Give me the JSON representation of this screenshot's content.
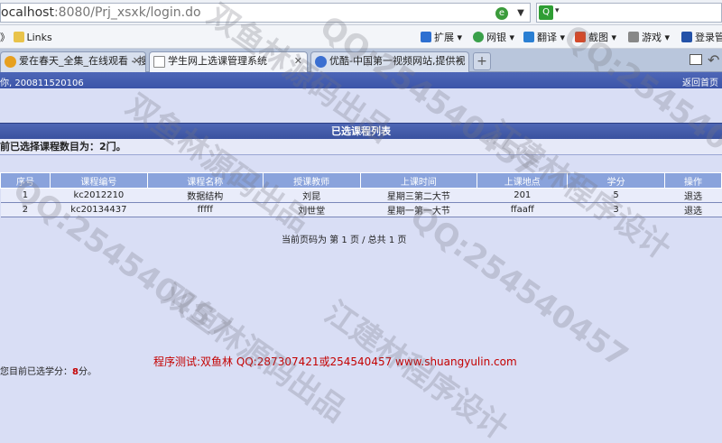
{
  "browser": {
    "url_main": "ocalhost",
    "url_rest": ":8080/Prj_xsxk/login.do",
    "bookmarks_link": "Links",
    "toolbar": [
      "扩展",
      "网银",
      "翻译",
      "截图",
      "游戏",
      "登录管"
    ],
    "tabs": [
      {
        "label": "爱在春天_全集_在线观看 - 搜"
      },
      {
        "label": "学生网上选课管理系统"
      },
      {
        "label": "优酷-中国第一视频网站,提供视"
      }
    ]
  },
  "header": {
    "welcome": "你, 200811520106",
    "home_link": "返回首页"
  },
  "list": {
    "title": "已选课程列表",
    "count_text": "前已选择课程数目为：2门。",
    "columns": [
      "序号",
      "课程编号",
      "课程名称",
      "授课教师",
      "上课时间",
      "上课地点",
      "学分",
      "操作"
    ],
    "rows": [
      [
        "1",
        "kc2012210",
        "数据结构",
        "刘昆",
        "星期三第二大节",
        "201",
        "5",
        "退选"
      ],
      [
        "2",
        "kc20134437",
        "fffff",
        "刘世堂",
        "星期一第一大节",
        "ffaaff",
        "3",
        "退选"
      ]
    ],
    "pager_prefix": "当前页码为 第",
    "pager_page": "1",
    "pager_mid": "页 / 总共",
    "pager_total": "1",
    "pager_suffix": "页"
  },
  "footer": {
    "contact": "程序测试:双鱼林 QQ:287307421或254540457 www.shuangyulin.com",
    "credits_prefix": "您目前已选学分：",
    "credits_value": "8",
    "credits_suffix": "分。"
  },
  "watermark": {
    "qq": "QQ:254540457",
    "cn1": "双鱼林源码出品",
    "cn2": "江建林程序设计"
  }
}
